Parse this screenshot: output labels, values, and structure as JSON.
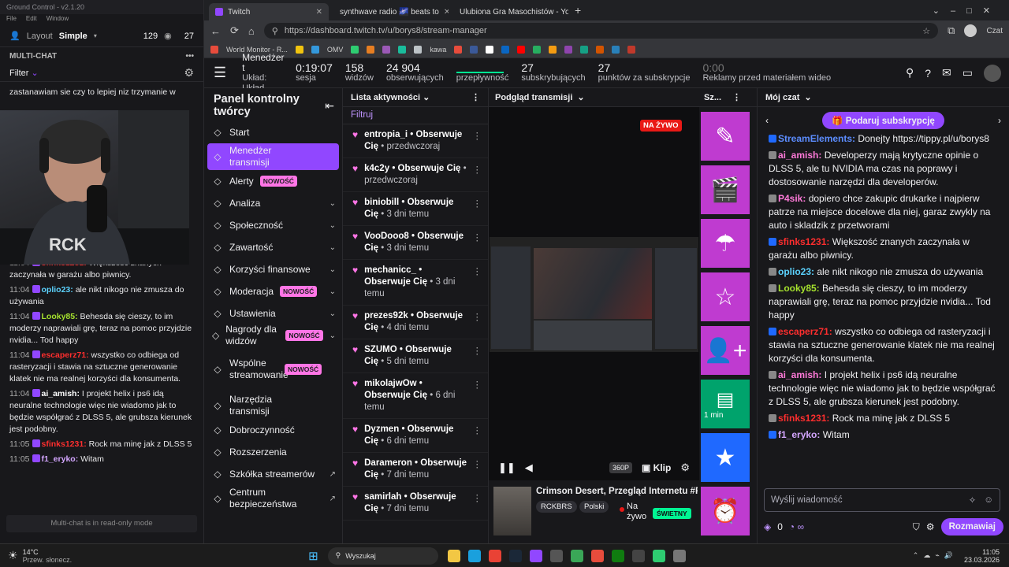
{
  "gc": {
    "title": "Ground Control - v2.1.20",
    "menu": [
      "File",
      "Edit",
      "Window"
    ],
    "layout_label": "Layout",
    "layout_value": "Simple",
    "viewers": "129",
    "viewers2": "27",
    "multichat": "MULTI-CHAT",
    "filter": "Filter",
    "readonly": "Multi-chat is in read-only mode",
    "messages": [
      {
        "time": "",
        "user": "",
        "color": "#ffffff",
        "text": "zastanawiam sie czy to lepiej niz trzymanie w pokoju"
      },
      {
        "time": "",
        "user": "",
        "color": "#ffffff",
        "text": "garaz zwykly na auto i skladzik z przetworami"
      },
      {
        "time": "11:04",
        "user": "sfinks1231:",
        "color": "#ff2e2e",
        "text": "Większość znanych zaczynała w garażu albo piwnicy."
      },
      {
        "time": "11:04",
        "user": "oplio23:",
        "color": "#5cd3ff",
        "text": "ale nikt nikogo nie zmusza do używania"
      },
      {
        "time": "11:04",
        "user": "Looky85:",
        "color": "#a6e22e",
        "text": "Behesda się cieszy, to im moderzy naprawiali grę, teraz na pomoc przyjdzie nvidia... Tod happy"
      },
      {
        "time": "11:04",
        "user": "escaperz71:",
        "color": "#ff2e2e",
        "text": "wszystko co odbiega od rasteryzacji i stawia na sztuczne generowanie klatek nie ma realnej korzyści dla konsumenta."
      },
      {
        "time": "11:04",
        "user": "ai_amish:",
        "color": "#ffffff",
        "text": "I projekt helix i ps6 idą neuralne technologie więc nie wiadomo jak to będzie współgrać z DLSS 5, ale grubsza kierunek jest podobny."
      },
      {
        "time": "11:05",
        "user": "sfinks1231:",
        "color": "#ff2e2e",
        "text": "Rock ma minę jak z DLSS 5"
      },
      {
        "time": "11:05",
        "user": "f1_eryko:",
        "color": "#d4a6ff",
        "text": "Witam"
      }
    ]
  },
  "browser": {
    "tabs": [
      {
        "label": "Twitch"
      },
      {
        "label": "synthwave radio 🌌 beats to"
      },
      {
        "label": "Ulubiona Gra Masochistów - YouT"
      }
    ],
    "url": "https://dashboard.twitch.tv/u/borys8/stream-manager",
    "profile": "Czat",
    "bookmarks": [
      "World Monitor - R...",
      "OMV",
      "kawa"
    ]
  },
  "header": {
    "manager_title": "Menedżer t",
    "manager_sub": "Układ: Układ",
    "stats": [
      {
        "value": "0:19:07",
        "label": "sesja"
      },
      {
        "value": "158",
        "label": "widzów"
      },
      {
        "value": "24 904",
        "label": "obserwujących"
      },
      {
        "value": "",
        "label": "przepływność"
      },
      {
        "value": "27",
        "label": "subskrybujących"
      },
      {
        "value": "27",
        "label": "punktów za subskrypcje"
      },
      {
        "value": "0:00",
        "label": "Reklamy przed materiałem wideo"
      }
    ]
  },
  "sidebar": {
    "title": "Panel kontrolny twórcy",
    "new_label": "NOWOŚĆ",
    "items": [
      {
        "label": "Start",
        "icon": "home-icon"
      },
      {
        "label": "Menedżer transmisji",
        "icon": "broadcast-icon",
        "active": true
      },
      {
        "label": "Alerty",
        "icon": "alert-icon",
        "new": true
      },
      {
        "label": "Analiza",
        "icon": "analytics-icon",
        "chev": true
      },
      {
        "label": "Społeczność",
        "icon": "community-icon",
        "chev": true
      },
      {
        "label": "Zawartość",
        "icon": "content-icon",
        "chev": true
      },
      {
        "label": "Korzyści finansowe",
        "icon": "money-icon",
        "chev": true
      },
      {
        "label": "Moderacja",
        "icon": "shield-icon",
        "new": true,
        "chev": true
      },
      {
        "label": "Ustawienia",
        "icon": "gear-icon",
        "chev": true
      },
      {
        "label": "Nagrody dla widzów",
        "icon": "smile-icon",
        "new": true,
        "chev": true
      },
      {
        "label": "Wspólne streamowanie",
        "icon": "add-user-icon",
        "new": true
      },
      {
        "label": "Narzędzia transmisji",
        "icon": "tools-icon"
      },
      {
        "label": "Dobroczynność",
        "icon": "charity-icon"
      },
      {
        "label": "Rozszerzenia",
        "icon": "puzzle-icon"
      },
      {
        "label": "Szkółka streamerów",
        "icon": "book-icon",
        "ext": true
      },
      {
        "label": "Centrum bezpieczeństwa",
        "icon": "lock-icon",
        "ext": true
      }
    ]
  },
  "activity": {
    "title": "Lista aktywności",
    "filter": "Filtruj",
    "items": [
      {
        "user": "entropia_i",
        "action": "• Obserwuje Cię",
        "time": "• przedwczoraj"
      },
      {
        "user": "k4c2y",
        "action": "• Obserwuje Cię",
        "time": "• przedwczoraj"
      },
      {
        "user": "biniobill",
        "action": "• Obserwuje Cię",
        "time": "• 3 dni temu"
      },
      {
        "user": "VooDooo8",
        "action": "• Obserwuje Cię",
        "time": "• 3 dni temu"
      },
      {
        "user": "mechanicc_",
        "action": "• Obserwuje Cię",
        "time": "• 3 dni temu"
      },
      {
        "user": "prezes92k",
        "action": "• Obserwuje Cię",
        "time": "• 4 dni temu"
      },
      {
        "user": "SZUMO",
        "action": "• Obserwuje Cię",
        "time": "• 5 dni temu"
      },
      {
        "user": "mikolajwOw",
        "action": "• Obserwuje Cię",
        "time": "• 6 dni temu"
      },
      {
        "user": "Dyzmen",
        "action": "• Obserwuje Cię",
        "time": "• 6 dni temu"
      },
      {
        "user": "Darameron",
        "action": "• Obserwuje Cię",
        "time": "• 7 dni temu"
      },
      {
        "user": "samirlah",
        "action": "• Obserwuje Cię",
        "time": "• 7 dni temu"
      }
    ]
  },
  "preview": {
    "title": "Podgląd transmisji",
    "live": "NA ŻYWO",
    "quality": "360P",
    "clip": "Klip",
    "stream_title": "Crimson Desert, Przegląd Internetu #RC",
    "tags": [
      "RCKBRS",
      "Polski"
    ],
    "status": "Na żywo",
    "health": "ŚWIETNY"
  },
  "shortcuts": {
    "short_title": "Sz...",
    "timer": "1 min"
  },
  "chat": {
    "title": "Mój czat",
    "gift": "Podaruj subskrypcję",
    "input_placeholder": "Wyślij wiadomość",
    "points": "0",
    "send": "Rozmawiaj",
    "messages": [
      {
        "user": "StreamElements:",
        "color": "#5c8dff",
        "text": "Donejty https://tippy.pl/u/borys8"
      },
      {
        "user": "ai_amish:",
        "color": "#ff7ad9",
        "text": "Developerzy mają krytyczne opinie o DLSS 5, ale tu NVIDIA ma czas na poprawy i dostosowanie narzędzi dla developerów."
      },
      {
        "user": "P4sik:",
        "color": "#ff7ad9",
        "text": "dopiero chce zakupic drukarke i najpierw patrze na miejsce docelowe dla niej, garaz zwykly na auto i skladzik z przetworami"
      },
      {
        "user": "sfinks1231:",
        "color": "#ff2e2e",
        "text": "Większość znanych zaczynała w garażu albo piwnicy."
      },
      {
        "user": "oplio23:",
        "color": "#5cd3ff",
        "text": "ale nikt nikogo nie zmusza do używania"
      },
      {
        "user": "Looky85:",
        "color": "#a6e22e",
        "text": "Behesda się cieszy, to im moderzy naprawiali grę, teraz na pomoc przyjdzie nvidia... Tod happy"
      },
      {
        "user": "escaperz71:",
        "color": "#ff2e2e",
        "text": "wszystko co odbiega od rasteryzacji i stawia na sztuczne generowanie klatek nie ma realnej korzyści dla konsumenta."
      },
      {
        "user": "ai_amish:",
        "color": "#ff7ad9",
        "text": "I projekt helix i ps6 idą neuralne technologie więc nie wiadomo jak to będzie współgrać z DLSS 5, ale grubsza kierunek jest podobny."
      },
      {
        "user": "sfinks1231:",
        "color": "#ff2e2e",
        "text": "Rock ma minę jak z DLSS 5"
      },
      {
        "user": "f1_eryko:",
        "color": "#d4a6ff",
        "text": "Witam"
      }
    ]
  },
  "taskbar": {
    "temp": "14°C",
    "weather": "Przew. słonecz.",
    "search": "Wyszukaj",
    "time": "11:05",
    "date": "23.03.2026"
  }
}
